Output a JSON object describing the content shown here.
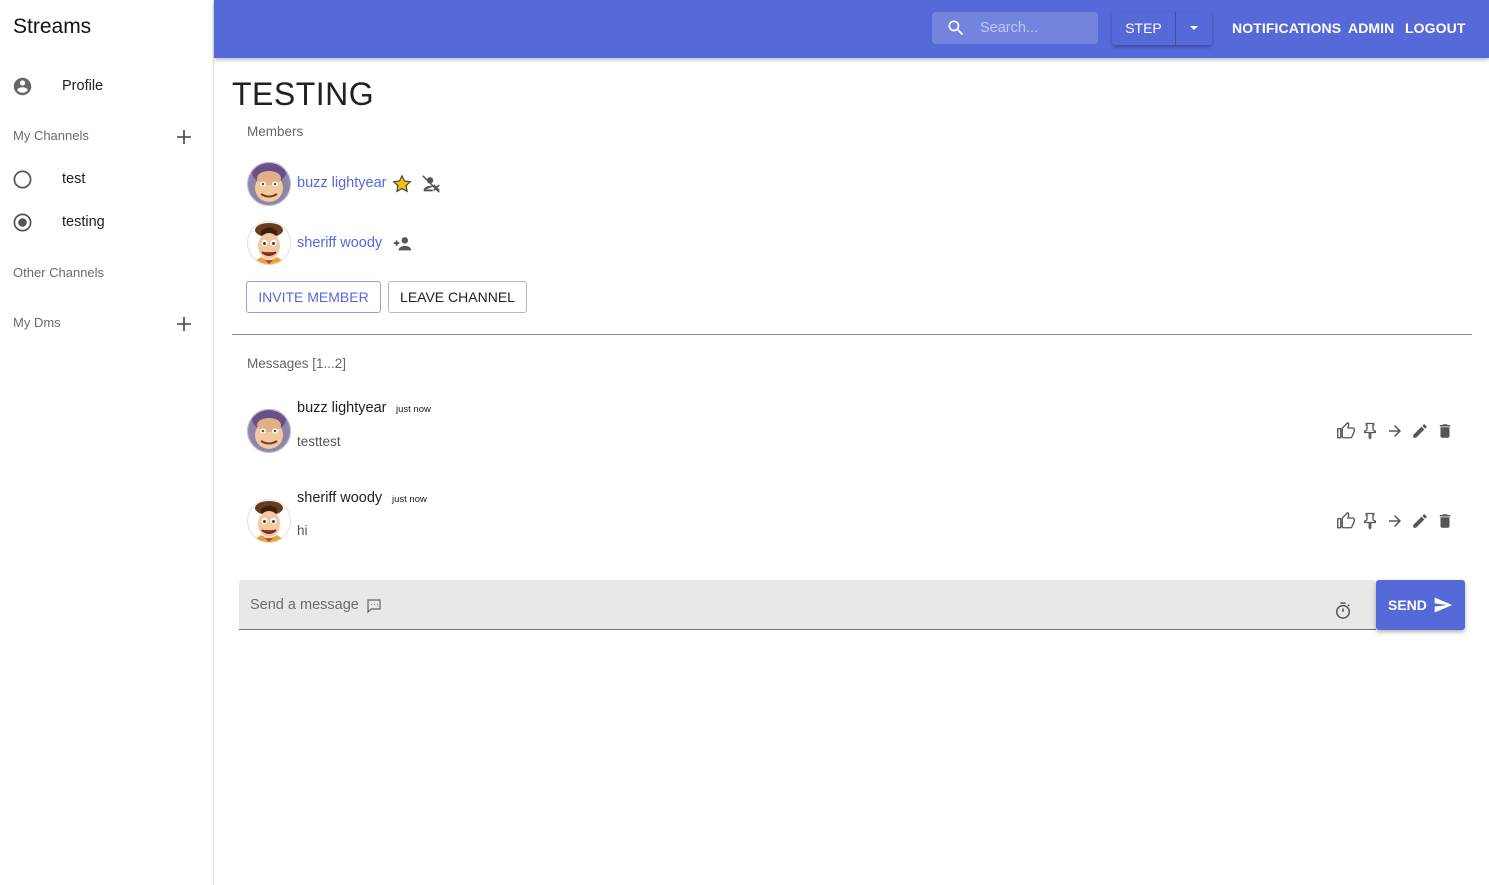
{
  "sidebar": {
    "brand": "Streams",
    "profile_label": "Profile",
    "my_channels_label": "My Channels",
    "channels": [
      {
        "label": "test",
        "selected": false
      },
      {
        "label": "testing",
        "selected": true
      }
    ],
    "other_channels_label": "Other Channels",
    "my_dms_label": "My Dms"
  },
  "appbar": {
    "search_placeholder": "Search...",
    "split_button_label": "STEP",
    "nav_links": [
      "NOTIFICATIONS",
      "ADMIN",
      "LOGOUT"
    ]
  },
  "channel": {
    "title": "TESTING",
    "members_label": "Members",
    "members": [
      {
        "name": "buzz lightyear",
        "is_owner": true,
        "action_icon": "remove-owner-icon"
      },
      {
        "name": "sheriff woody",
        "is_owner": false,
        "action_icon": "make-owner-icon"
      }
    ],
    "invite_label": "INVITE MEMBER",
    "leave_label": "LEAVE CHANNEL"
  },
  "messages": {
    "label": "Messages [1...2]",
    "items": [
      {
        "author": "buzz lightyear",
        "time": "just now",
        "body": "testtest"
      },
      {
        "author": "sheriff woody",
        "time": "just now",
        "body": "hi"
      }
    ],
    "actions": [
      "thumb-up-icon",
      "pin-icon",
      "forward-icon",
      "edit-icon",
      "delete-icon"
    ]
  },
  "composer": {
    "placeholder": "Send a message",
    "send_label": "SEND"
  },
  "colors": {
    "primary": "#5569d8",
    "link": "#5569d8",
    "star": "#f4c20d"
  }
}
